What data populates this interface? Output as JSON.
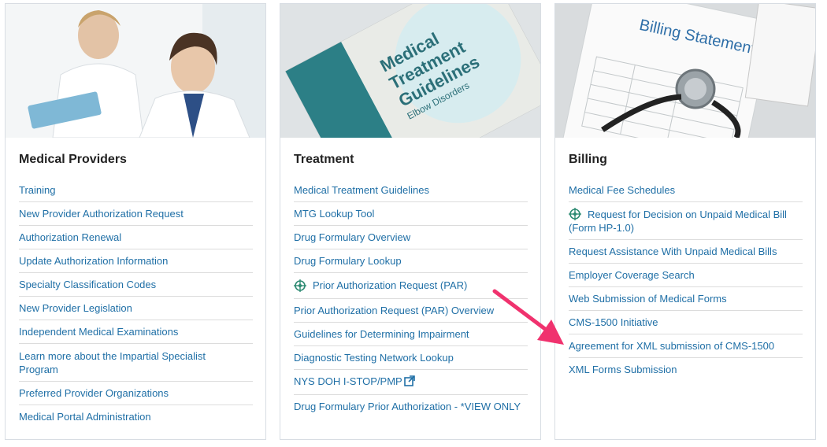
{
  "cards": [
    {
      "title": "Medical Providers",
      "links": [
        "Training",
        "New Provider Authorization Request",
        "Authorization Renewal",
        "Update Authorization Information",
        "Specialty Classification Codes",
        "New Provider Legislation",
        "Independent Medical Examinations",
        "Learn more about the Impartial Specialist Program",
        "Preferred Provider Organizations",
        "Medical Portal Administration"
      ]
    },
    {
      "title": "Treatment",
      "book_text": [
        "Medical",
        "Treatment",
        "Guidelines",
        "Elbow Disorders"
      ],
      "links": [
        "Medical Treatment Guidelines",
        "MTG Lookup Tool",
        "Drug Formulary Overview",
        "Drug Formulary Lookup",
        "Prior Authorization Request (PAR)",
        "Prior Authorization Request (PAR) Overview",
        "Guidelines for Determining Impairment",
        "Diagnostic Testing Network Lookup",
        "NYS DOH I-STOP/PMP",
        "Drug Formulary Prior Authorization - *VIEW ONLY"
      ]
    },
    {
      "title": "Billing",
      "statement_text": "Billing Statement",
      "links": [
        "Medical Fee Schedules",
        "Request for Decision on Unpaid Medical Bill (Form HP-1.0)",
        "Request Assistance With Unpaid Medical Bills",
        "Employer Coverage Search",
        "Web Submission of Medical Forms",
        "CMS-1500 Initiative",
        "Agreement for XML submission of CMS-1500",
        "XML Forms Submission"
      ]
    }
  ],
  "colors": {
    "link": "#1f6fa6",
    "arrow": "#f0326e",
    "icon": "#2e8b73"
  },
  "icons": [
    "crosshair-app-icon",
    "external-link-icon",
    "pointer-arrow"
  ]
}
